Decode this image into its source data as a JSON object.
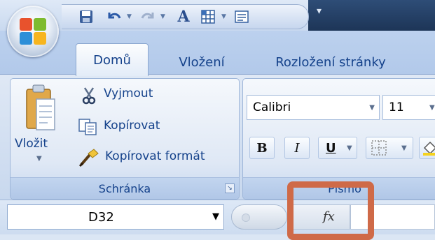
{
  "tabs": [
    {
      "label": "Domů",
      "active": true
    },
    {
      "label": "Vložení",
      "active": false
    },
    {
      "label": "Rozložení stránky",
      "active": false
    }
  ],
  "clipboard": {
    "group_label": "Schránka",
    "paste_label": "Vložit",
    "cut_label": "Vyjmout",
    "copy_label": "Kopírovat",
    "format_painter_label": "Kopírovat formát"
  },
  "font": {
    "group_label": "Písmo",
    "font_name": "Calibri",
    "font_size": "11",
    "bold_label": "B",
    "italic_label": "I",
    "underline_label": "U"
  },
  "formula_bar": {
    "name_box_value": "D32",
    "fx_label": "fx"
  },
  "qat": {
    "font_button_label": "A"
  },
  "colors": {
    "accent": "#15428b",
    "highlight": "#cf6a48"
  }
}
